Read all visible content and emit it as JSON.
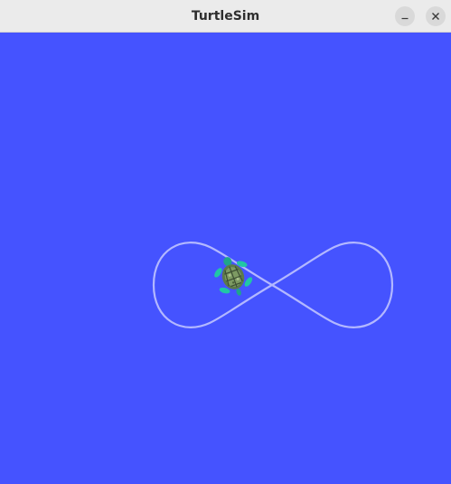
{
  "window": {
    "title": "TurtleSim"
  },
  "titlebar": {
    "minimize_icon": "minimize-icon",
    "close_icon": "close-icon"
  },
  "canvas": {
    "background_color": "#4553ff",
    "pen_color": "#b3b8ff",
    "path_shape": "figure-eight",
    "turtle_icon": "turtle-icon"
  }
}
